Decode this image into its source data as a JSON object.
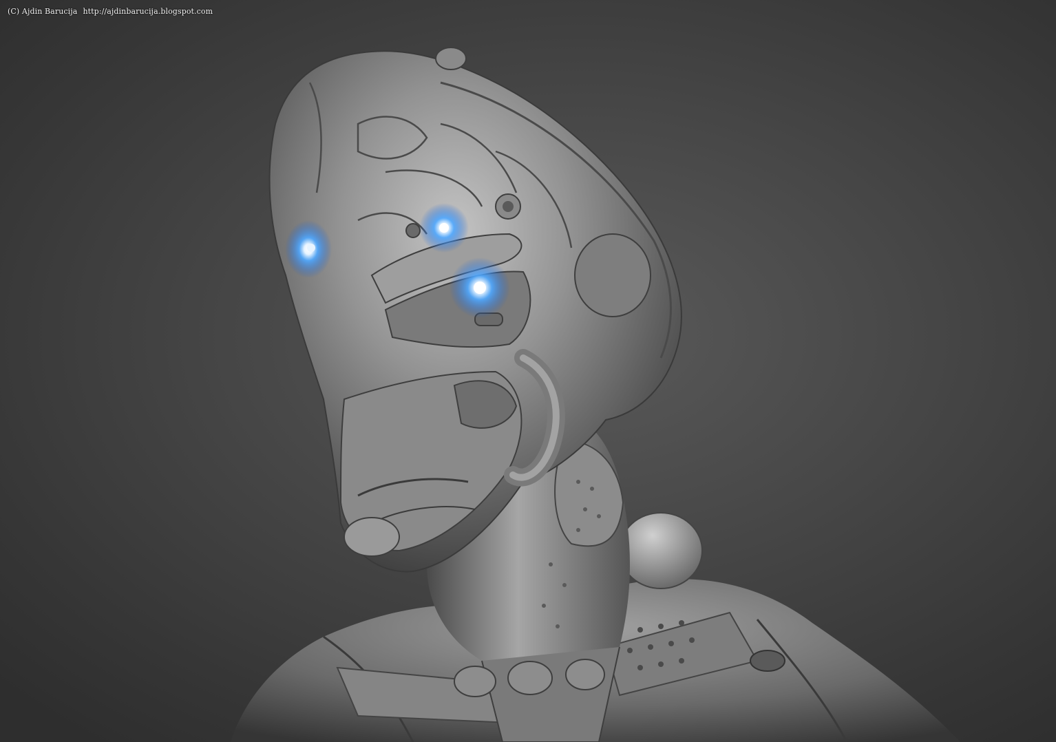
{
  "watermark": {
    "author": "(C) Ajdin Barucija",
    "url": "http://ajdinbarucija.blogspot.com"
  },
  "render": {
    "subject": "sculpted-cyborg-bust",
    "material_color": "#8a8a8a",
    "eye_glow_color": "#4fa8ff",
    "background_color": "#3c3c3c"
  }
}
